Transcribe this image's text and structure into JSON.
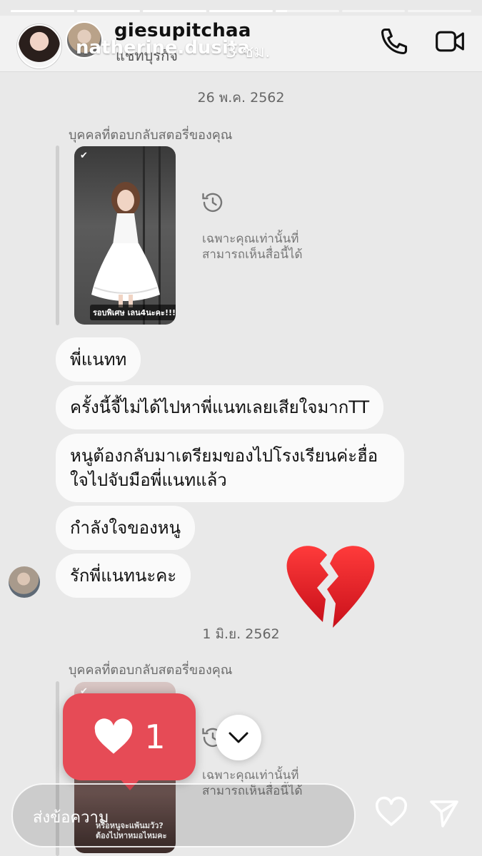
{
  "progress": [
    1.0,
    1.0,
    1.0,
    1.0,
    0.18,
    0.0,
    0.0
  ],
  "header": {
    "username": "giesupitchaa",
    "subtitle": "แชทบุรกิจ",
    "overlay_name": "natherine.dusita",
    "overlay_time": "3 ชม."
  },
  "icons": {
    "call": "phone-icon",
    "video": "video-camera-icon",
    "clock": "history-clock-icon",
    "like": "heart-icon",
    "send": "send-paper-plane-icon",
    "broken": "broken-heart-emoji"
  },
  "chat": {
    "date1": "26 พ.ค. 2562",
    "reply_label": "บุคคลที่ตอบกลับสตอรี่ของคุณ",
    "only_you_text": "เฉพาะคุณเท่านั้นที่สามารถเห็นสื่อนี้ได้",
    "story1_caption": "รอบพิเศษ เลน4นะคะ!!!❤️",
    "messages": [
      "พี่แนทท",
      "ครั้งนี้จี้ไม่ได้ไปหาพี่แนทเลยเสียใจมากTT",
      "หนูต้องกลับมาเตรียมของไปโรงเรียนค่ะฮื่อ ใจไปจับมือพี่แนทแล้ว",
      "กำลังใจของหนู",
      "รักพี่แนทนะคะ"
    ],
    "date2": "1 มิ.ย. 2562",
    "reply_label2": "บุคคลที่ตอบกลับสตอรี่ของคุณ",
    "only_you_text2": "เฉพาะคุณเท่านั้นที่สามารถเห็นสื่อนี้ได้",
    "story2_caption_line1": "หรือหนูจะแพ้นมวัว?",
    "story2_caption_line2": "ต้องไปหาหมอไหมคะ"
  },
  "like_card": {
    "count": "1"
  },
  "footer": {
    "placeholder": "ส่งข้อความ"
  },
  "colors": {
    "like_red": "#e64b56",
    "bubble_bg": "#fafafa",
    "page_bg": "#e9e9e9"
  }
}
